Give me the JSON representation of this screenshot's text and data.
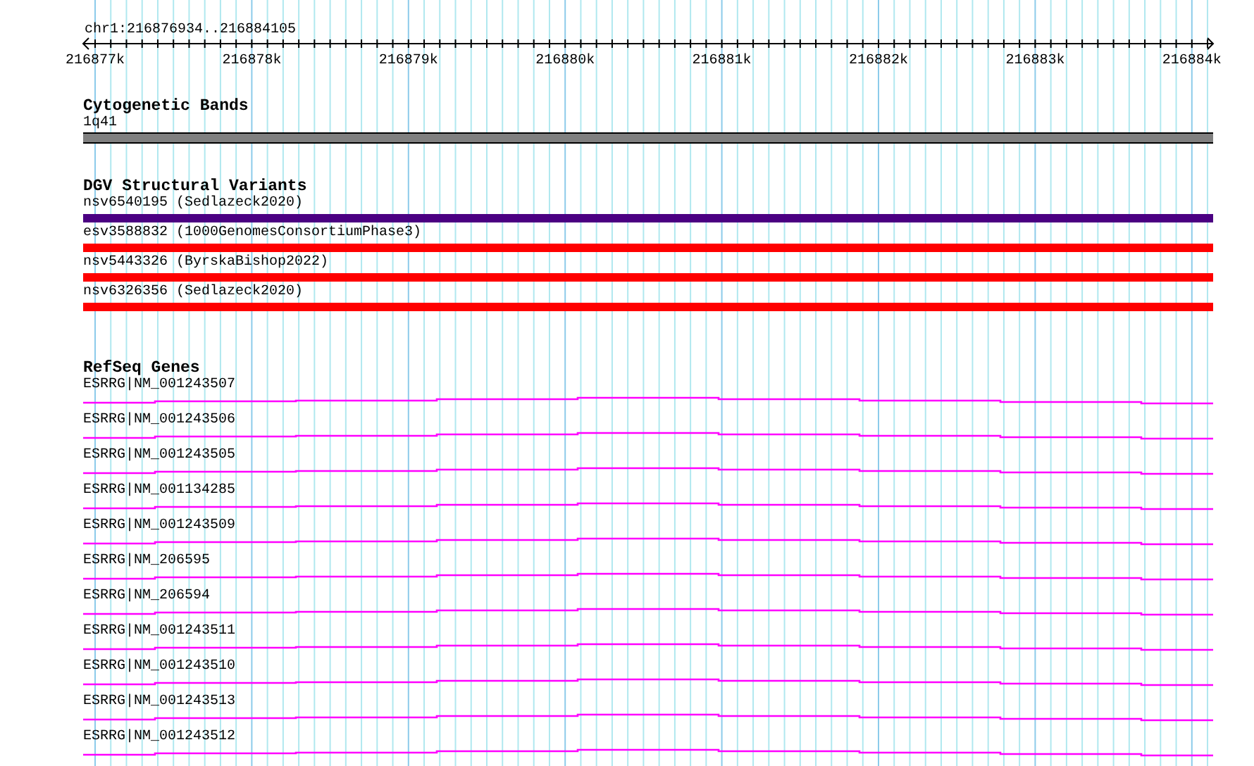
{
  "ruler": {
    "location": "chr1:216876934..216884105",
    "ticks": [
      "216877k",
      "216878k",
      "216879k",
      "216880k",
      "216881k",
      "216882k",
      "216883k",
      "216884k"
    ]
  },
  "tracks": [
    {
      "kind": "bands",
      "title": "Cytogenetic Bands",
      "features": [
        {
          "label": "1q41"
        }
      ]
    },
    {
      "kind": "variants",
      "title": "DGV Structural Variants",
      "features": [
        {
          "label": "nsv6540195 (Sedlazeck2020)",
          "color": "#4b0082"
        },
        {
          "label": "esv3588832 (1000GenomesConsortiumPhase3)",
          "color": "#ff0000"
        },
        {
          "label": "nsv5443326 (ByrskaBishop2022)",
          "color": "#ff0000"
        },
        {
          "label": "nsv6326356 (Sedlazeck2020)",
          "color": "#ff0000"
        }
      ]
    },
    {
      "kind": "genes",
      "title": "RefSeq Genes",
      "features": [
        {
          "label": "ESRRG|NM_001243507"
        },
        {
          "label": "ESRRG|NM_001243506"
        },
        {
          "label": "ESRRG|NM_001243505"
        },
        {
          "label": "ESRRG|NM_001134285"
        },
        {
          "label": "ESRRG|NM_001243509"
        },
        {
          "label": "ESRRG|NM_206595"
        },
        {
          "label": "ESRRG|NM_206594"
        },
        {
          "label": "ESRRG|NM_001243511"
        },
        {
          "label": "ESRRG|NM_001243510"
        },
        {
          "label": "ESRRG|NM_001243513"
        },
        {
          "label": "ESRRG|NM_001243512"
        }
      ]
    }
  ]
}
